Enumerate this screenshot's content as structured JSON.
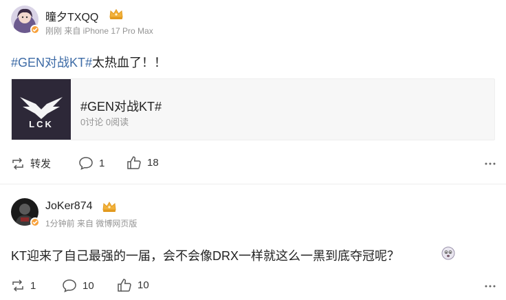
{
  "post1": {
    "username": "曈夕TXQQ",
    "meta": "刚刚 来自 iPhone 17 Pro Max",
    "text_hashtag": "#GEN对战KT#",
    "text_rest": "太热血了！！",
    "topic": {
      "title": "#GEN对战KT#",
      "stats": "0讨论 0阅读",
      "logo_text": "LCK"
    },
    "actions": {
      "repost": "转发",
      "comments": "1",
      "likes": "18"
    }
  },
  "post2": {
    "username": "JoKer874",
    "meta": "1分钟前 来自 微博网页版",
    "text": "KT迎来了自己最强的一届，会不会像DRX一样就这么一黑到底夺冠呢？",
    "actions": {
      "reposts": "1",
      "comments": "10",
      "likes": "10"
    }
  },
  "colors": {
    "hashtag_blue": "#3d6ba6",
    "verified_badge": "#f7a13b",
    "crown_gold": "#f2b13a",
    "meta_gray": "#939393"
  },
  "icons": [
    "repost-icon",
    "comment-icon",
    "like-icon",
    "more-icon",
    "crown-icon",
    "verified-icon",
    "emoji-icon"
  ]
}
